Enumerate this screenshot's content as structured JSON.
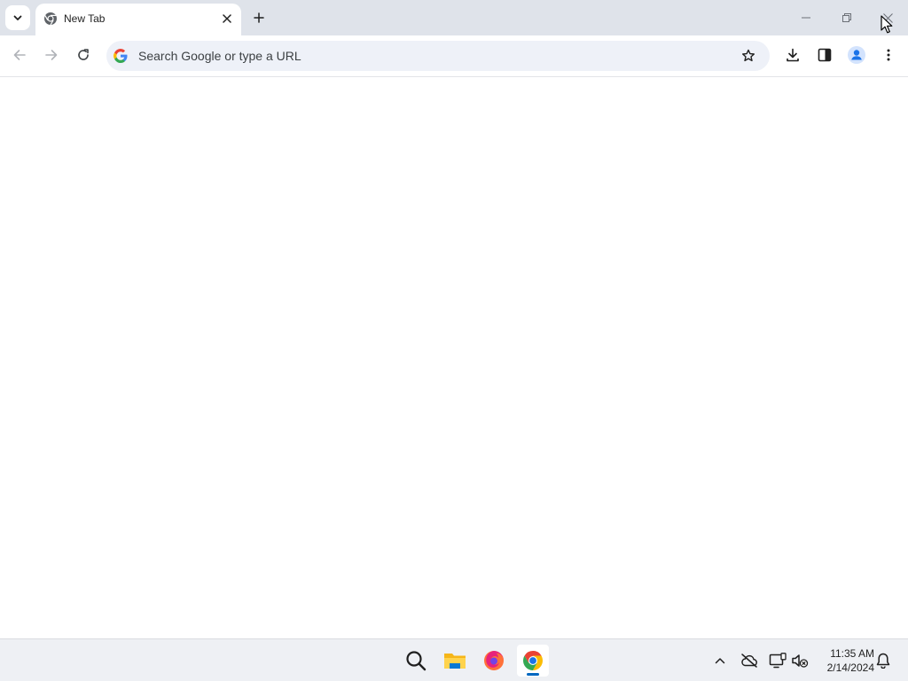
{
  "browser": {
    "tab": {
      "title": "New Tab"
    },
    "omnibox": {
      "placeholder": "Search Google or type a URL",
      "value": ""
    }
  },
  "taskbar": {
    "apps": [
      "search-icon",
      "file-explorer-icon",
      "firefox-icon",
      "chrome-icon"
    ],
    "active_app": "chrome-icon",
    "clock": {
      "time": "11:35 AM",
      "date": "2/14/2024"
    }
  },
  "colors": {
    "tabstrip_bg": "#dfe3ea",
    "omnibox_bg": "#eef1f8",
    "accent": "#0067c0",
    "profile_blue": "#1a73e8"
  }
}
